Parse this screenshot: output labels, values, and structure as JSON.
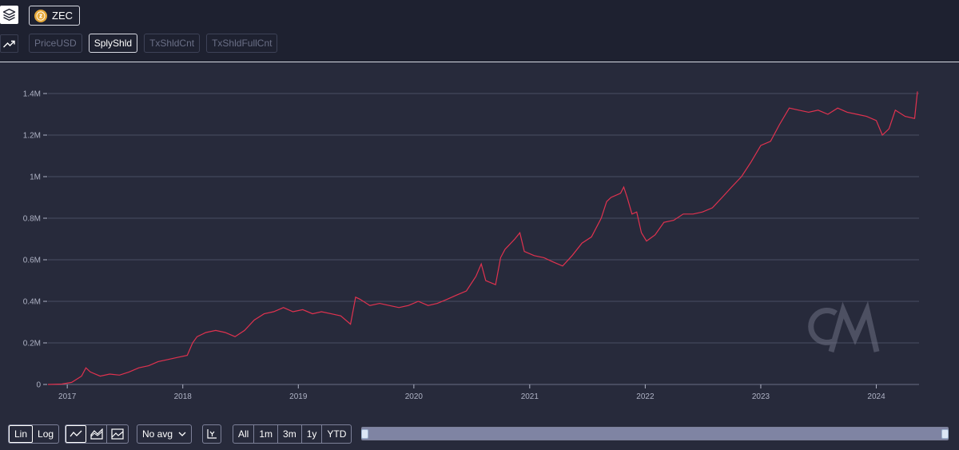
{
  "asset": {
    "symbol": "ZEC",
    "icon": "zcash-coin-icon",
    "glyph": "ⓩ"
  },
  "metric_tabs": [
    {
      "label": "PriceUSD",
      "active": false
    },
    {
      "label": "SplyShld",
      "active": true
    },
    {
      "label": "TxShldCnt",
      "active": false
    },
    {
      "label": "TxShldFullCnt",
      "active": false
    }
  ],
  "chart_data": {
    "type": "line",
    "series": [
      {
        "color": "#e0324f",
        "points": [
          [
            "2016-11-01",
            0
          ],
          [
            "2016-12-15",
            2000
          ],
          [
            "2017-01-15",
            10000
          ],
          [
            "2017-02-15",
            40000
          ],
          [
            "2017-03-01",
            80000
          ],
          [
            "2017-03-15",
            60000
          ],
          [
            "2017-04-15",
            40000
          ],
          [
            "2017-05-15",
            50000
          ],
          [
            "2017-06-15",
            45000
          ],
          [
            "2017-07-15",
            60000
          ],
          [
            "2017-08-15",
            80000
          ],
          [
            "2017-09-15",
            90000
          ],
          [
            "2017-10-15",
            110000
          ],
          [
            "2017-11-15",
            120000
          ],
          [
            "2017-12-15",
            130000
          ],
          [
            "2018-01-15",
            140000
          ],
          [
            "2018-02-01",
            200000
          ],
          [
            "2018-02-15",
            230000
          ],
          [
            "2018-03-15",
            250000
          ],
          [
            "2018-04-15",
            260000
          ],
          [
            "2018-05-15",
            250000
          ],
          [
            "2018-06-15",
            230000
          ],
          [
            "2018-07-15",
            260000
          ],
          [
            "2018-08-15",
            310000
          ],
          [
            "2018-09-15",
            340000
          ],
          [
            "2018-10-15",
            350000
          ],
          [
            "2018-11-15",
            370000
          ],
          [
            "2018-12-15",
            350000
          ],
          [
            "2019-01-15",
            360000
          ],
          [
            "2019-02-15",
            340000
          ],
          [
            "2019-03-15",
            350000
          ],
          [
            "2019-04-15",
            340000
          ],
          [
            "2019-05-15",
            330000
          ],
          [
            "2019-06-15",
            290000
          ],
          [
            "2019-07-01",
            420000
          ],
          [
            "2019-07-15",
            410000
          ],
          [
            "2019-08-15",
            380000
          ],
          [
            "2019-09-15",
            390000
          ],
          [
            "2019-10-15",
            380000
          ],
          [
            "2019-11-15",
            370000
          ],
          [
            "2019-12-15",
            380000
          ],
          [
            "2020-01-15",
            400000
          ],
          [
            "2020-02-15",
            380000
          ],
          [
            "2020-03-15",
            390000
          ],
          [
            "2020-04-15",
            410000
          ],
          [
            "2020-05-15",
            430000
          ],
          [
            "2020-06-15",
            450000
          ],
          [
            "2020-07-15",
            520000
          ],
          [
            "2020-08-01",
            580000
          ],
          [
            "2020-08-15",
            500000
          ],
          [
            "2020-09-15",
            480000
          ],
          [
            "2020-10-01",
            610000
          ],
          [
            "2020-10-15",
            650000
          ],
          [
            "2020-11-15",
            700000
          ],
          [
            "2020-12-01",
            730000
          ],
          [
            "2020-12-15",
            640000
          ],
          [
            "2021-01-15",
            620000
          ],
          [
            "2021-02-15",
            610000
          ],
          [
            "2021-03-15",
            590000
          ],
          [
            "2021-04-15",
            570000
          ],
          [
            "2021-05-15",
            620000
          ],
          [
            "2021-06-15",
            680000
          ],
          [
            "2021-07-15",
            710000
          ],
          [
            "2021-08-15",
            800000
          ],
          [
            "2021-09-01",
            880000
          ],
          [
            "2021-09-15",
            900000
          ],
          [
            "2021-10-15",
            920000
          ],
          [
            "2021-10-25",
            950000
          ],
          [
            "2021-11-05",
            900000
          ],
          [
            "2021-11-20",
            820000
          ],
          [
            "2021-12-05",
            830000
          ],
          [
            "2021-12-20",
            730000
          ],
          [
            "2022-01-05",
            690000
          ],
          [
            "2022-02-01",
            720000
          ],
          [
            "2022-03-01",
            780000
          ],
          [
            "2022-04-01",
            790000
          ],
          [
            "2022-05-01",
            820000
          ],
          [
            "2022-06-01",
            820000
          ],
          [
            "2022-07-01",
            830000
          ],
          [
            "2022-08-01",
            850000
          ],
          [
            "2022-09-01",
            900000
          ],
          [
            "2022-10-01",
            950000
          ],
          [
            "2022-11-01",
            1000000
          ],
          [
            "2022-12-01",
            1070000
          ],
          [
            "2023-01-01",
            1150000
          ],
          [
            "2023-02-01",
            1170000
          ],
          [
            "2023-03-01",
            1250000
          ],
          [
            "2023-04-01",
            1330000
          ],
          [
            "2023-05-01",
            1320000
          ],
          [
            "2023-06-01",
            1310000
          ],
          [
            "2023-07-01",
            1320000
          ],
          [
            "2023-08-01",
            1300000
          ],
          [
            "2023-09-01",
            1330000
          ],
          [
            "2023-10-01",
            1310000
          ],
          [
            "2023-11-01",
            1300000
          ],
          [
            "2023-12-01",
            1290000
          ],
          [
            "2024-01-01",
            1270000
          ],
          [
            "2024-01-20",
            1200000
          ],
          [
            "2024-02-10",
            1230000
          ],
          [
            "2024-03-01",
            1320000
          ],
          [
            "2024-04-01",
            1290000
          ],
          [
            "2024-05-01",
            1280000
          ],
          [
            "2024-05-10",
            1410000
          ]
        ]
      }
    ],
    "x_ticks": [
      "2017",
      "2018",
      "2019",
      "2020",
      "2021",
      "2022",
      "2023",
      "2024"
    ],
    "y_ticks": [
      {
        "value": 0,
        "label": "0"
      },
      {
        "value": 200000,
        "label": "0.2M"
      },
      {
        "value": 400000,
        "label": "0.4M"
      },
      {
        "value": 600000,
        "label": "0.6M"
      },
      {
        "value": 800000,
        "label": "0.8M"
      },
      {
        "value": 1000000,
        "label": "1M"
      },
      {
        "value": 1200000,
        "label": "1.2M"
      },
      {
        "value": 1400000,
        "label": "1.4M"
      }
    ],
    "xlim": [
      "2016-11-01",
      "2024-05-15"
    ],
    "ylim": [
      0,
      1400000
    ],
    "grid": true,
    "watermark": "CM"
  },
  "controls": {
    "scale": [
      {
        "label": "Lin",
        "selected": true
      },
      {
        "label": "Log",
        "selected": false
      }
    ],
    "chart_types": [
      "line-chart-icon",
      "area-chart-icon",
      "mountain-chart-icon"
    ],
    "avg": {
      "label": "No avg"
    },
    "y_axis_icon": "y-axis-icon",
    "ranges": [
      "All",
      "1m",
      "3m",
      "1y",
      "YTD"
    ]
  }
}
